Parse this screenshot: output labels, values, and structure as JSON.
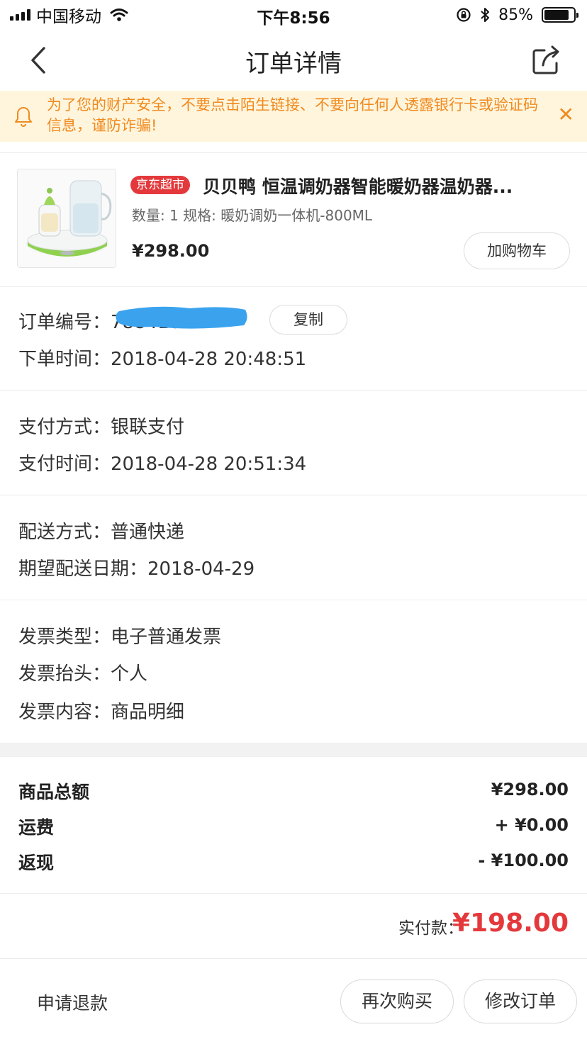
{
  "status_bar": {
    "carrier": "中国移动",
    "time": "下午8:56",
    "battery_percent": "85%",
    "battery_level": 0.85
  },
  "nav": {
    "title": "订单详情",
    "back_icon": "chevron-left-icon",
    "share_icon": "share-icon"
  },
  "notice": {
    "text": "为了您的财产安全，不要点击陌生链接、不要向任何人透露银行卡或验证码信息，谨防诈骗!",
    "close": "✕",
    "icon": "bell-icon",
    "color": "#f08a1e",
    "background": "#fff5dd"
  },
  "product": {
    "tag": "京东超市",
    "title": "贝贝鸭 恒温调奶器智能暖奶器温奶器...",
    "spec": "数量: 1 规格: 暖奶调奶一体机-800ML",
    "price": "¥298.00",
    "add_cart": "加购物车"
  },
  "order": {
    "number_label": "订单编号：",
    "number_value": "7884180",
    "copy": "复制",
    "time_label": "下单时间：",
    "time_value": "2018-04-28 20:48:51"
  },
  "payment": {
    "method_label": "支付方式：",
    "method_value": "银联支付",
    "time_label": "支付时间：",
    "time_value": "2018-04-28 20:51:34"
  },
  "delivery": {
    "method_label": "配送方式：",
    "method_value": "普通快递",
    "date_label": "期望配送日期：",
    "date_value": "2018-04-29"
  },
  "invoice": {
    "type_label": "发票类型：",
    "type_value": "电子普通发票",
    "title_label": "发票抬头：",
    "title_value": "个人",
    "content_label": "发票内容：",
    "content_value": "商品明细"
  },
  "summary": {
    "goods_label": "商品总额",
    "goods_value": "¥298.00",
    "shipping_label": "运费",
    "shipping_value": "+ ¥0.00",
    "cashback_label": "返现",
    "cashback_value": "- ¥100.00"
  },
  "paid": {
    "label": "实付款：",
    "value": "¥198.00",
    "color": "#e4393c"
  },
  "actions": {
    "refund": "申请退款",
    "rebuy": "再次购买",
    "modify": "修改订单"
  }
}
